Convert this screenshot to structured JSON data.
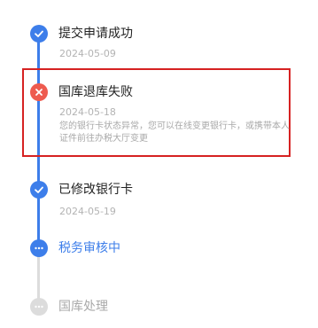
{
  "colors": {
    "accent": "#3d7eea",
    "error": "#ee5b4f",
    "pending": "#dcdcdc",
    "highlight": "#d62222"
  },
  "timeline": [
    {
      "status": "done",
      "icon": "check-icon",
      "title": "提交申请成功",
      "date": "2024-05-09"
    },
    {
      "status": "failed",
      "icon": "close-icon",
      "title": "国库退库失败",
      "date": "2024-05-18",
      "description": "您的银行卡状态异常，您可以在线变更银行卡，或携带本人证件前往办税大厅变更"
    },
    {
      "status": "done",
      "icon": "check-icon",
      "title": "已修改银行卡",
      "date": "2024-05-19"
    },
    {
      "status": "active",
      "icon": "ellipsis-icon",
      "title": "税务审核中"
    },
    {
      "status": "pending",
      "icon": "ellipsis-icon",
      "title": "国库处理"
    }
  ]
}
